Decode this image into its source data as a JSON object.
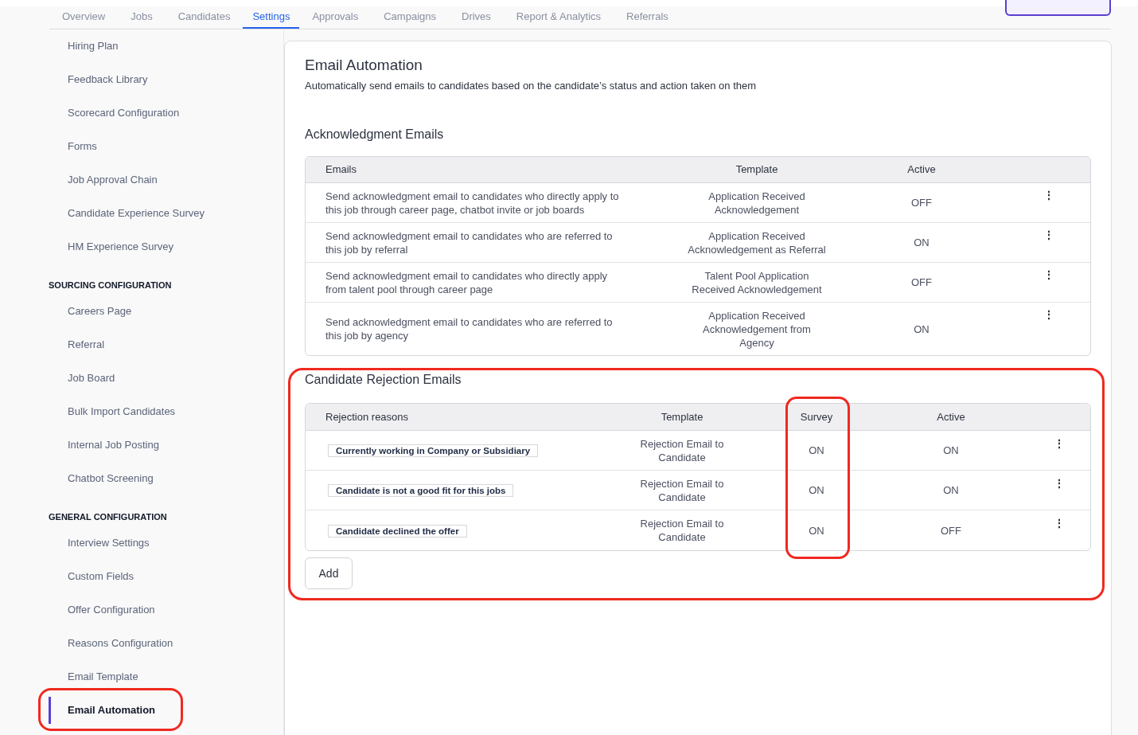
{
  "tabs": [
    {
      "label": "Overview",
      "selected": false
    },
    {
      "label": "Jobs",
      "selected": false
    },
    {
      "label": "Candidates",
      "selected": false
    },
    {
      "label": "Settings",
      "selected": true
    },
    {
      "label": "Approvals",
      "selected": false
    },
    {
      "label": "Campaigns",
      "selected": false
    },
    {
      "label": "Drives",
      "selected": false
    },
    {
      "label": "Report & Analytics",
      "selected": false
    },
    {
      "label": "Referrals",
      "selected": false
    }
  ],
  "sidebar": {
    "sections": [
      {
        "items": [
          {
            "label": "Hiring Plan",
            "selected": false
          },
          {
            "label": "Feedback Library",
            "selected": false
          },
          {
            "label": "Scorecard Configuration",
            "selected": false
          },
          {
            "label": "Forms",
            "selected": false
          },
          {
            "label": "Job Approval Chain",
            "selected": false
          },
          {
            "label": "Candidate Experience Survey",
            "selected": false
          },
          {
            "label": "HM Experience Survey",
            "selected": false
          }
        ]
      },
      {
        "heading": "SOURCING CONFIGURATION",
        "items": [
          {
            "label": "Careers Page",
            "selected": false
          },
          {
            "label": "Referral",
            "selected": false
          },
          {
            "label": "Job Board",
            "selected": false
          },
          {
            "label": "Bulk Import Candidates",
            "selected": false
          },
          {
            "label": "Internal Job Posting",
            "selected": false
          },
          {
            "label": "Chatbot Screening",
            "selected": false
          }
        ]
      },
      {
        "heading": "GENERAL CONFIGURATION",
        "items": [
          {
            "label": "Interview Settings",
            "selected": false
          },
          {
            "label": "Custom Fields",
            "selected": false
          },
          {
            "label": "Offer Configuration",
            "selected": false
          },
          {
            "label": "Reasons Configuration",
            "selected": false
          },
          {
            "label": "Email Template",
            "selected": false
          },
          {
            "label": "Email Automation",
            "selected": true
          }
        ]
      }
    ]
  },
  "page": {
    "title": "Email Automation",
    "subtitle": "Automatically send emails to candidates based on the candidate’s status and action taken on them"
  },
  "acknowledgment": {
    "title": "Acknowledgment Emails",
    "columns": [
      "Emails",
      "Template",
      "Active"
    ],
    "rows": [
      {
        "email": "Send acknowledgment email to candidates who directly apply to this job through career page, chatbot invite or job boards",
        "template": "Application Received Acknowledgement",
        "active": "OFF",
        "menu": "⋮"
      },
      {
        "email": "Send acknowledgment email to candidates who are referred to this job by referral",
        "template": "Application Received Acknowledgement as Referral",
        "active": "ON",
        "menu": "⋮"
      },
      {
        "email": "Send acknowledgment email to candidates who directly apply from talent pool through career page",
        "template": "Talent Pool Application Received Acknowledgement",
        "active": "OFF",
        "menu": "⋮"
      },
      {
        "email": "Send acknowledgment email to candidates who are referred to this job by agency",
        "template": "Application Received Acknowledgement from Agency",
        "active": "ON",
        "menu": "⋮"
      }
    ]
  },
  "rejection": {
    "title": "Candidate Rejection Emails",
    "columns": [
      "Rejection reasons",
      "Template",
      "Survey",
      "Active"
    ],
    "rows": [
      {
        "reason": "Currently working in Company or Subsidiary",
        "template": "Rejection Email to Candidate",
        "survey": "ON",
        "active": "ON",
        "menu": "⋮"
      },
      {
        "reason": "Candidate is not a good fit for this jobs",
        "template": "Rejection Email to Candidate",
        "survey": "ON",
        "active": "ON",
        "menu": "⋮"
      },
      {
        "reason": "Candidate declined the offer",
        "template": "Rejection Email to Candidate",
        "survey": "ON",
        "active": "OFF",
        "menu": "⋮"
      }
    ],
    "add_button": "Add"
  }
}
